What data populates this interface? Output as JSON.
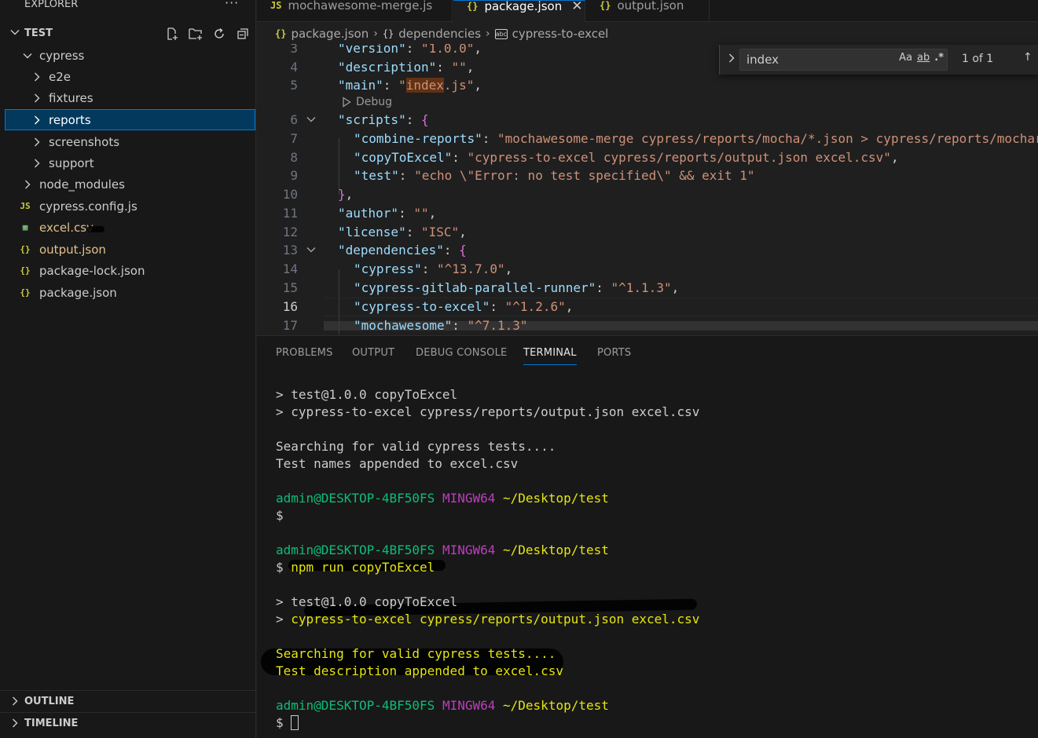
{
  "explorer": {
    "title": "EXPLORER",
    "more": "···",
    "section_title": "TEST",
    "items": [
      {
        "label": "cypress",
        "kind": "folder-open"
      },
      {
        "label": "e2e",
        "kind": "folder"
      },
      {
        "label": "fixtures",
        "kind": "folder"
      },
      {
        "label": "reports",
        "kind": "folder",
        "selected": true
      },
      {
        "label": "screenshots",
        "kind": "folder"
      },
      {
        "label": "support",
        "kind": "folder"
      },
      {
        "label": "node_modules",
        "kind": "folder"
      },
      {
        "label": "cypress.config.js",
        "kind": "file-js",
        "icon": "JS"
      },
      {
        "label": "excel.csv",
        "kind": "file-csv",
        "icon": "▦"
      },
      {
        "label": "output.json",
        "kind": "file-json",
        "icon": "{}"
      },
      {
        "label": "package-lock.json",
        "kind": "file-json",
        "icon": "{}"
      },
      {
        "label": "package.json",
        "kind": "file-json",
        "icon": "{}"
      }
    ],
    "outline": "OUTLINE",
    "timeline": "TIMELINE"
  },
  "tabs": [
    {
      "label": "mochawesome-merge.js",
      "icon": "JS",
      "active": false
    },
    {
      "label": "package.json",
      "icon": "{}",
      "active": true,
      "close": "✕"
    },
    {
      "label": "output.json",
      "icon": "{}",
      "active": false
    }
  ],
  "breadcrumb": {
    "file": "package.json",
    "file_icon": "{}",
    "section": "dependencies",
    "section_icon": "{}",
    "leaf": "cypress-to-excel",
    "leaf_icon": "abc",
    "sep": "›"
  },
  "editor": {
    "codelens": "Debug",
    "lines": [
      {
        "n": "3",
        "k": "\"version\"",
        "v": "\"1.0.0\"",
        "tail": ","
      },
      {
        "n": "4",
        "k": "\"description\"",
        "v": "\"\"",
        "tail": ","
      },
      {
        "n": "5",
        "k": "\"main\"",
        "v_pre": "\"",
        "v_hl": "index",
        "v_post": ".js\"",
        "tail": ","
      },
      {
        "n": "6",
        "k": "\"scripts\"",
        "open": "{"
      },
      {
        "n": "7",
        "k": "\"combine-reports\"",
        "v": "\"mochawesome-merge cypress/reports/mocha/*.json > cypress/reports/mochar"
      },
      {
        "n": "8",
        "k": "\"copyToExcel\"",
        "v": "\"cypress-to-excel cypress/reports/output.json excel.csv\"",
        "tail": ","
      },
      {
        "n": "9",
        "k": "\"test\"",
        "v": "\"echo \\\"Error: no test specified\\\" && exit 1\""
      },
      {
        "n": "10",
        "close": "}",
        "tail": ","
      },
      {
        "n": "11",
        "k": "\"author\"",
        "v": "\"\"",
        "tail": ","
      },
      {
        "n": "12",
        "k": "\"license\"",
        "v": "\"ISC\"",
        "tail": ","
      },
      {
        "n": "13",
        "k": "\"dependencies\"",
        "open": "{"
      },
      {
        "n": "14",
        "k": "\"cypress\"",
        "v": "\"^13.7.0\"",
        "tail": ","
      },
      {
        "n": "15",
        "k": "\"cypress-gitlab-parallel-runner\"",
        "v": "\"^1.1.3\"",
        "tail": ","
      },
      {
        "n": "16",
        "k": "\"cypress-to-excel\"",
        "v": "\"^1.2.6\"",
        "tail": ","
      },
      {
        "n": "17",
        "k": "\"mochawesome\"",
        "v": "\"^7.1.3\""
      }
    ]
  },
  "find": {
    "value": "index",
    "opt_case": "Aa",
    "opt_word": "ab",
    "opt_regex": ".*",
    "count": "1 of 1",
    "up": "↑"
  },
  "panel": {
    "tabs": [
      "PROBLEMS",
      "OUTPUT",
      "DEBUG CONSOLE",
      "TERMINAL",
      "PORTS"
    ],
    "active_tab": "TERMINAL"
  },
  "terminal": {
    "l1": "> test@1.0.0 copyToExcel",
    "l2": "> cypress-to-excel cypress/reports/output.json excel.csv",
    "l3": "Searching for valid cypress tests....",
    "l4": "Test names appended to excel.csv",
    "user": "admin@DESKTOP-4BF50FS",
    "shell": "MINGW64",
    "path": "~/Desktop/test",
    "dollar": "$",
    "cmd": "npm run copyToExcel",
    "l5": "> test@1.0.0 copyToExcel",
    "l6_prefix": "> ",
    "l6_cmd": "cypress-to-excel",
    "l6_rest": " cypress/reports/output.json excel.csv",
    "l7": "Searching for valid cypress tests....",
    "l8": "Test description appended to excel.csv"
  },
  "colors": {
    "accent": "#0078d4",
    "selection": "#04395e",
    "string": "#ce9178",
    "key": "#9cdcfe",
    "prompt_user": "#23d18b",
    "prompt_shell": "#bc3fbc",
    "prompt_path": "#e5e510"
  }
}
